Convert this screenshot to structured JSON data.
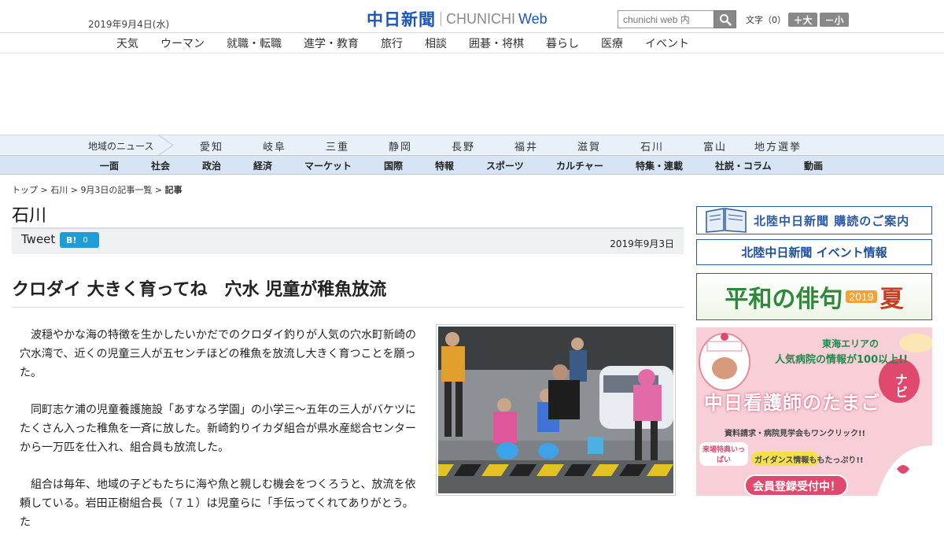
{
  "header": {
    "date": "2019年9月4日(水)",
    "logo_jp": "中日新聞",
    "logo_en": "CHUNICHI",
    "logo_web": "Web",
    "search_placeholder": "chunichi web 内",
    "fontsize_label": "文字（0）",
    "font_larger": "＋大",
    "font_smaller": "－小"
  },
  "topnav": [
    "天気",
    "ウーマン",
    "就職・転職",
    "進学・教育",
    "旅行",
    "相談",
    "囲碁・将棋",
    "暮らし",
    "医療",
    "イベント"
  ],
  "regional_nav": {
    "label": "地域のニュース",
    "items": [
      "愛知",
      "岐阜",
      "三重",
      "静岡",
      "長野",
      "福井",
      "滋賀",
      "石川",
      "富山",
      "地方選挙"
    ]
  },
  "section_nav": [
    "一面",
    "社会",
    "政治",
    "経済",
    "マーケット",
    "国際",
    "特報",
    "スポーツ",
    "カルチャー",
    "特集・連載",
    "社説・コラム",
    "動画"
  ],
  "breadcrumb": {
    "top": "トップ",
    "region": "石川",
    "list": "9月3日の記事一覧",
    "current": "記事"
  },
  "page_title": "石川",
  "share": {
    "tweet": "Tweet",
    "hatena_label": "B!",
    "hatena_count": "0",
    "date": "2019年9月3日"
  },
  "article": {
    "headline": "クロダイ 大きく育ってね　穴水 児童が稚魚放流",
    "paragraphs": [
      "波穏やかな海の特徴を生かしたいかだでのクロダイ釣りが人気の穴水町新崎の穴水湾で、近くの児童三人が五センチほどの稚魚を放流し大きく育つことを願った。",
      "同町志ケ浦の児童養護施設「あすなろ学園」の小学三～五年の三人がバケツにたくさん入った稚魚を一斉に放した。新崎釣りイカダ組合が県水産総合センターから一万匹を仕入れ、組合員も放流した。",
      "組合は毎年、地域の子どもたちに海や魚と親しむ機会をつくろうと、放流を依頼している。岩田正樹組合長（７１）は児童らに「手伝ってくれてありがとう。た"
    ]
  },
  "sidebar": {
    "banner1": "北陸中日新聞 購読のご案内",
    "banner2": "北陸中日新聞 イベント情報",
    "banner3_main": "平和の俳句",
    "banner3_year": "2019",
    "banner3_season": "夏",
    "banner4": {
      "lead1": "東海エリアの",
      "lead2": "人気病院の情報が100以上!!",
      "title": "中日看護師のたまご",
      "navi": "ナビ",
      "line1": "資料請求・病院見学会もワンクリック!!",
      "badge": "来場特典いっぱい",
      "line2": "ガイダンス情報ももたっぷり!!",
      "cta": "会員登録受付中！"
    }
  }
}
